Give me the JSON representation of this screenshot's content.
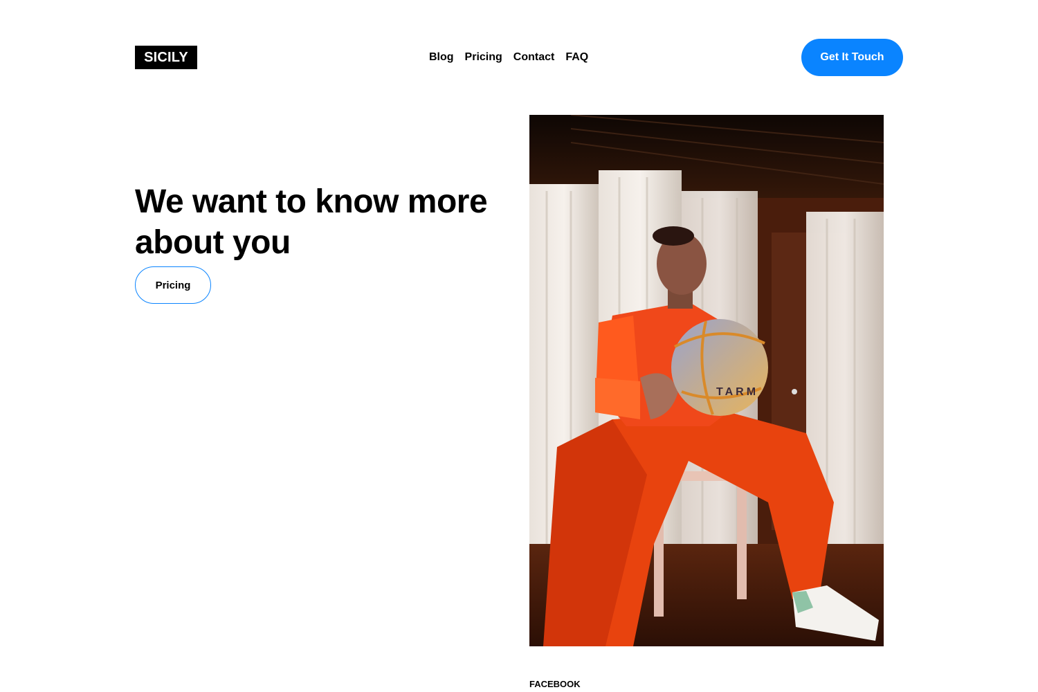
{
  "header": {
    "logo": "SICILY",
    "nav": [
      "Blog",
      "Pricing",
      "Contact",
      "FAQ"
    ],
    "cta_label": "Get It Touch"
  },
  "hero": {
    "headline": "We want to know more about you",
    "button_label": "Pricing"
  },
  "photo": {
    "ball_text": "TARM"
  },
  "footer": {
    "social_link": "FACEBOOK"
  },
  "colors": {
    "accent": "#0a84ff",
    "text": "#000000",
    "background": "#ffffff"
  }
}
